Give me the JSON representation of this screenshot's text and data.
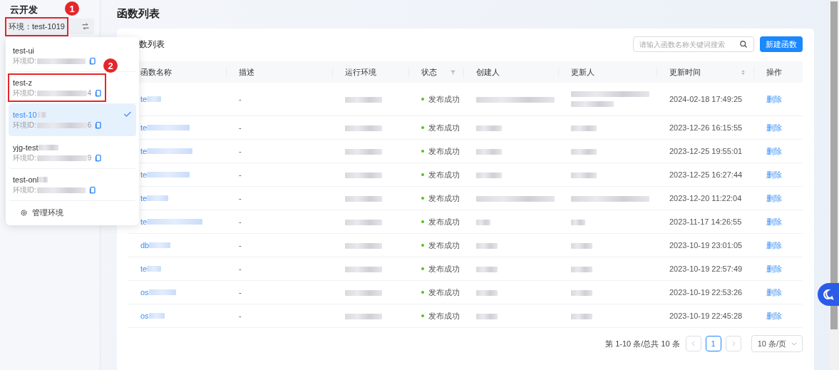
{
  "sidebar": {
    "title": "云开发",
    "env_label": "环境：test-1019",
    "annotation": "1"
  },
  "env_menu": {
    "items": [
      {
        "name": "test-ui",
        "id_label": "环境ID:",
        "selected": false
      },
      {
        "name": "test-z",
        "id_label": "环境ID:",
        "id_tail": "4",
        "selected": false,
        "annotation": "2"
      },
      {
        "name": "test-10",
        "id_label": "环境ID:",
        "id_tail": "6",
        "selected": true
      },
      {
        "name": "yjg-test",
        "id_label": "环境ID:",
        "id_tail": "9",
        "selected": false
      },
      {
        "name": "test-onl",
        "id_label": "环境ID:",
        "selected": false
      }
    ],
    "manage": "管理环境"
  },
  "page_title": "函数列表",
  "card": {
    "title": "数列表",
    "search": {
      "placeholder": "请输入函数名称关键词搜索"
    },
    "new_button": "新建函数"
  },
  "table": {
    "columns": [
      {
        "label": "函数名称",
        "kind": "plain"
      },
      {
        "label": "描述",
        "kind": "plain"
      },
      {
        "label": "运行环境",
        "kind": "plain"
      },
      {
        "label": "状态",
        "kind": "filter"
      },
      {
        "label": "创建人",
        "kind": "plain"
      },
      {
        "label": "更新人",
        "kind": "plain"
      },
      {
        "label": "更新时间",
        "kind": "sort"
      },
      {
        "label": "操作",
        "kind": "plain"
      }
    ],
    "rows": [
      {
        "name": "te",
        "description": "-",
        "status": "发布成功",
        "updated": "2024-02-18 17:49:25",
        "action": "删除"
      },
      {
        "name": "te",
        "description": "-",
        "status": "发布成功",
        "updated": "2023-12-26 16:15:55",
        "action": "删除"
      },
      {
        "name": "te",
        "description": "-",
        "status": "发布成功",
        "updated": "2023-12-25 19:55:01",
        "action": "删除"
      },
      {
        "name": "te",
        "description": "-",
        "status": "发布成功",
        "updated": "2023-12-25 16:27:44",
        "action": "删除"
      },
      {
        "name": "te",
        "description": "-",
        "status": "发布成功",
        "updated": "2023-12-20 11:22:04",
        "action": "删除"
      },
      {
        "name": "te",
        "description": "-",
        "status": "发布成功",
        "updated": "2023-11-17 14:26:55",
        "action": "删除"
      },
      {
        "name": "db",
        "description": "-",
        "status": "发布成功",
        "updated": "2023-10-19 23:01:05",
        "action": "删除"
      },
      {
        "name": "te",
        "description": "-",
        "status": "发布成功",
        "updated": "2023-10-19 22:57:49",
        "action": "删除"
      },
      {
        "name": "os",
        "description": "-",
        "status": "发布成功",
        "updated": "2023-10-19 22:53:26",
        "action": "删除"
      },
      {
        "name": "os",
        "description": "-",
        "status": "发布成功",
        "updated": "2023-10-19 22:45:28",
        "action": "删除"
      }
    ]
  },
  "pagination": {
    "summary": "第 1-10 条/总共 10 条",
    "pages": [
      {
        "label": "1",
        "selected": true
      }
    ],
    "page_size": "10 条/页"
  }
}
